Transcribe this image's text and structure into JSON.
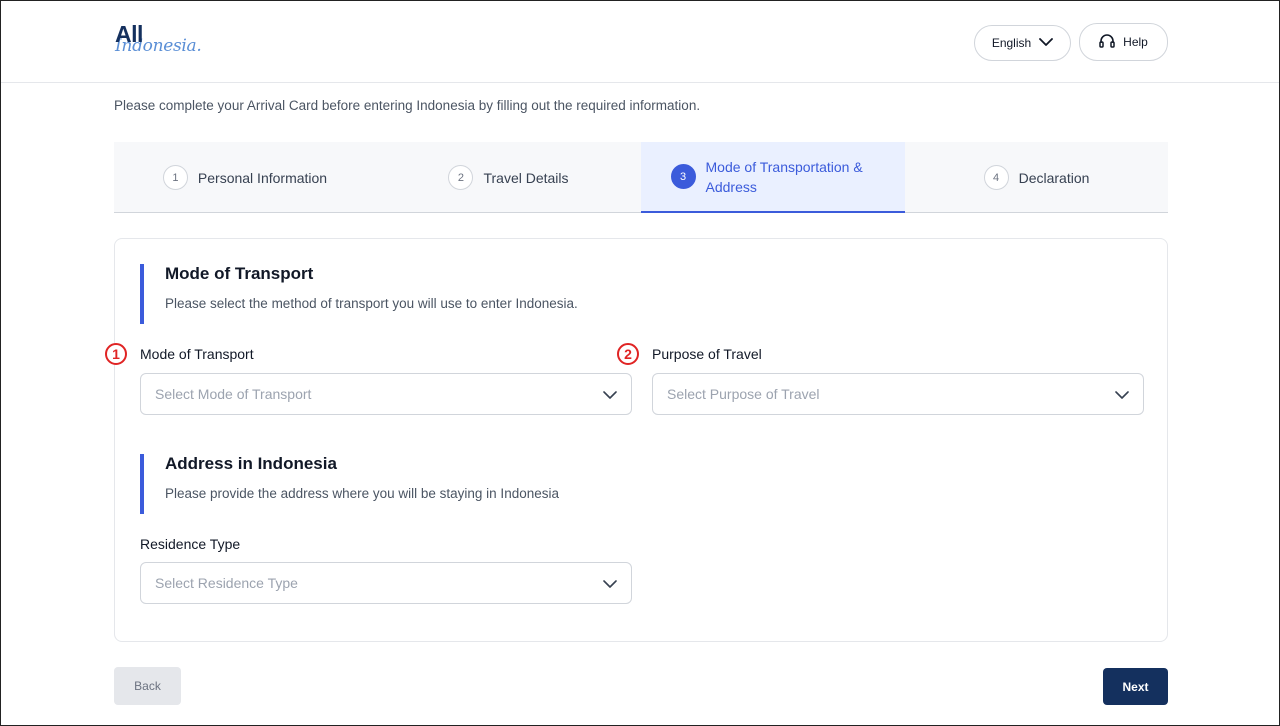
{
  "header": {
    "logo_main": "All",
    "logo_sub": "Indonesia.",
    "language_label": "English",
    "help_label": "Help"
  },
  "intro_text": "Please complete your Arrival Card before entering Indonesia by filling out the required information.",
  "steps": [
    {
      "number": "1",
      "label": "Personal Information",
      "active": false
    },
    {
      "number": "2",
      "label": "Travel Details",
      "active": false
    },
    {
      "number": "3",
      "label": "Mode of Transportation & Address",
      "active": true
    },
    {
      "number": "4",
      "label": "Declaration",
      "active": false
    }
  ],
  "transport_section": {
    "title": "Mode of Transport",
    "subtitle": "Please select the method of transport you will use to enter Indonesia.",
    "mode_field": {
      "label": "Mode of Transport",
      "placeholder": "Select Mode of Transport",
      "marker": "1"
    },
    "purpose_field": {
      "label": "Purpose of Travel",
      "placeholder": "Select Purpose of Travel",
      "marker": "2"
    }
  },
  "address_section": {
    "title": "Address in Indonesia",
    "subtitle": "Please provide the address where you will be staying in Indonesia",
    "residence_field": {
      "label": "Residence Type",
      "placeholder": "Select Residence Type"
    }
  },
  "footer": {
    "back_label": "Back",
    "next_label": "Next"
  },
  "colors": {
    "accent": "#3b5bdb",
    "primary_dark": "#14305e",
    "marker_red": "#e02424"
  },
  "icons": {
    "language_dropdown": "chevron-down-icon",
    "help": "headset-icon",
    "select_dropdown": "chevron-down-icon"
  }
}
